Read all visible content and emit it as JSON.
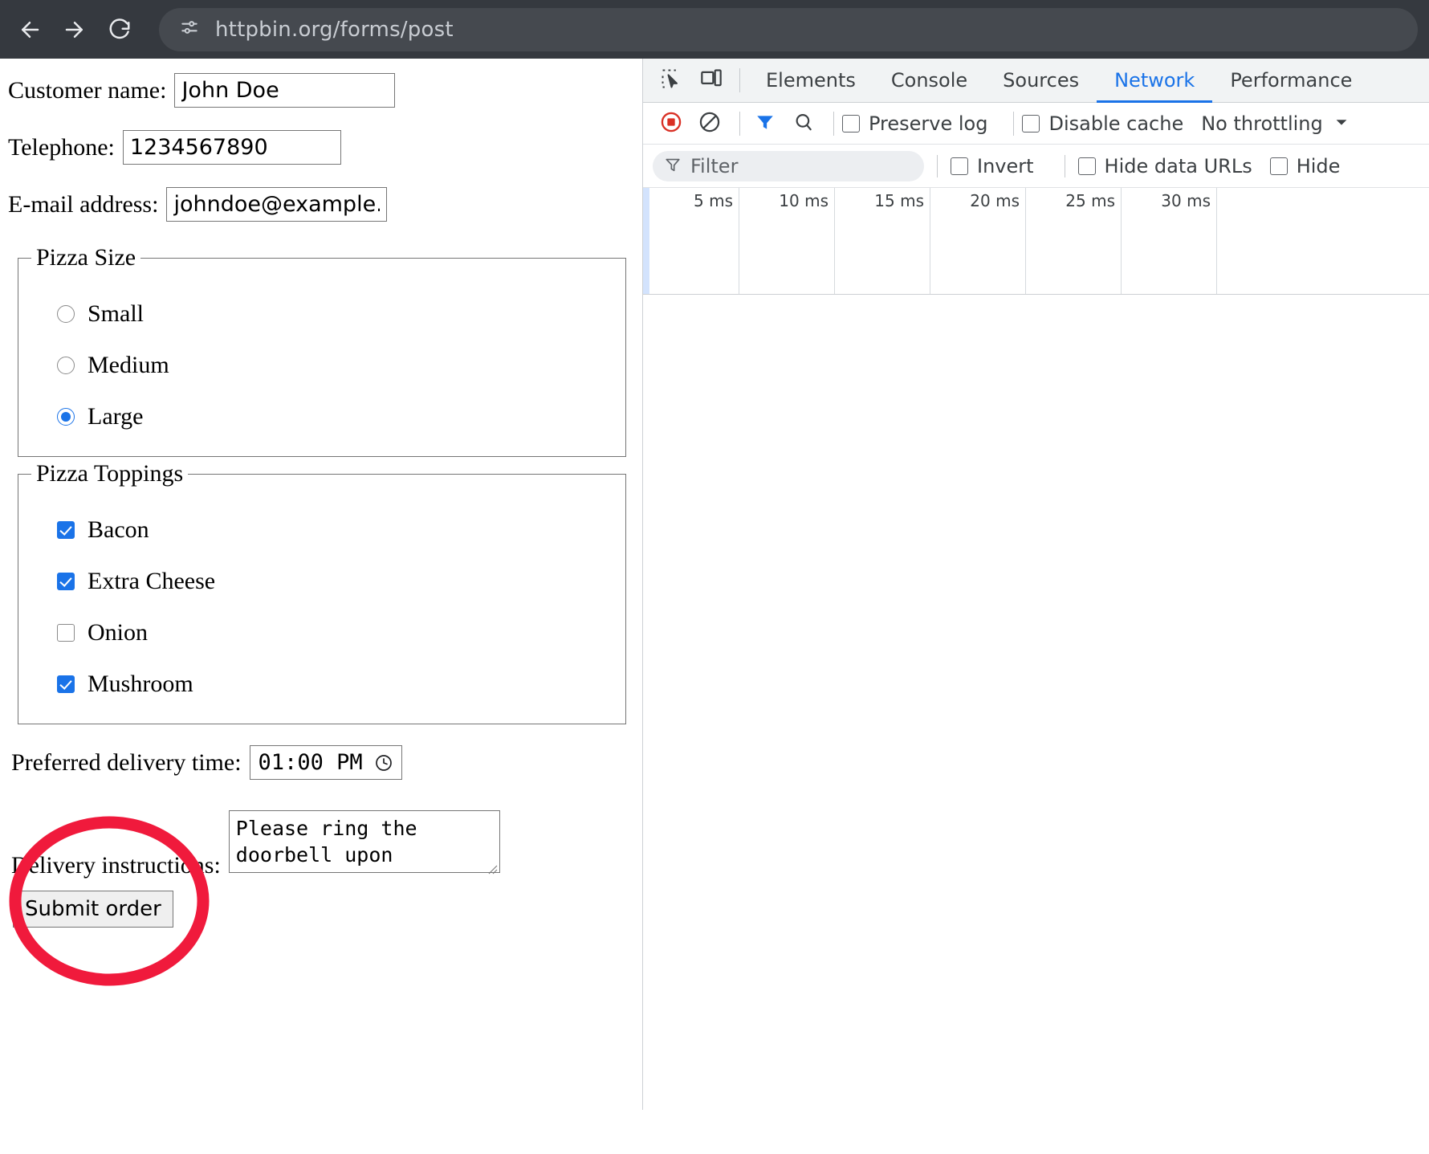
{
  "browser": {
    "back_icon": "arrow-left-icon",
    "forward_icon": "arrow-right-icon",
    "reload_icon": "reload-icon",
    "site_info_icon": "tune-settings-icon",
    "url": "httpbin.org/forms/post",
    "bar_color": "#35393f",
    "omnibox_color": "#45494f"
  },
  "form": {
    "fields": [
      {
        "label": "Customer name:",
        "value": "John Doe",
        "name": "customer-name"
      },
      {
        "label": "Telephone:",
        "value": "1234567890",
        "name": "telephone"
      },
      {
        "label": "E-mail address:",
        "value": "johndoe@example.com",
        "name": "email"
      }
    ],
    "size_group": {
      "legend": "Pizza Size",
      "options": [
        {
          "label": "Small",
          "checked": false
        },
        {
          "label": "Medium",
          "checked": false
        },
        {
          "label": "Large",
          "checked": true
        }
      ]
    },
    "toppings_group": {
      "legend": "Pizza Toppings",
      "options": [
        {
          "label": "Bacon",
          "checked": true
        },
        {
          "label": "Extra Cheese",
          "checked": true
        },
        {
          "label": "Onion",
          "checked": false
        },
        {
          "label": "Mushroom",
          "checked": true
        }
      ]
    },
    "delivery_time": {
      "label": "Preferred delivery time:",
      "value": "01:00 PM",
      "icon": "clock-icon"
    },
    "instructions": {
      "label": "Delivery instructions:",
      "value": "Please ring the doorbell upon arrival."
    },
    "submit_label": "Submit order",
    "annotation": {
      "shape": "ellipse",
      "color": "#f01a3c"
    },
    "accent_color": "#1a73e8"
  },
  "devtools": {
    "tabs": [
      {
        "label": "Elements",
        "active": false
      },
      {
        "label": "Console",
        "active": false
      },
      {
        "label": "Sources",
        "active": false
      },
      {
        "label": "Network",
        "active": true
      },
      {
        "label": "Performance",
        "active": false
      }
    ],
    "tab_icons": [
      "inspect-element-icon",
      "device-toolbar-icon"
    ],
    "toolbar": {
      "record_icon": "record-stop-icon",
      "clear_icon": "clear-network-log-icon",
      "filter_icon": "filter-funnel-icon",
      "search_icon": "search-icon",
      "preserve_log": {
        "label": "Preserve log",
        "checked": false
      },
      "disable_cache": {
        "label": "Disable cache",
        "checked": false
      },
      "throttling": "No throttling",
      "throttle_chevron": "chevron-down-icon"
    },
    "filterbar": {
      "placeholder": "Filter",
      "filter_icon": "filter-funnel-icon",
      "invert": {
        "label": "Invert",
        "checked": false
      },
      "hide_data_urls": {
        "label": "Hide data URLs",
        "checked": false
      },
      "hide_extension_urls": {
        "label": "Hide",
        "checked": false
      }
    },
    "timeline": {
      "ticks": [
        "5 ms",
        "10 ms",
        "15 ms",
        "20 ms",
        "25 ms",
        "30 ms"
      ]
    },
    "active_tab_color": "#1a73e8"
  }
}
